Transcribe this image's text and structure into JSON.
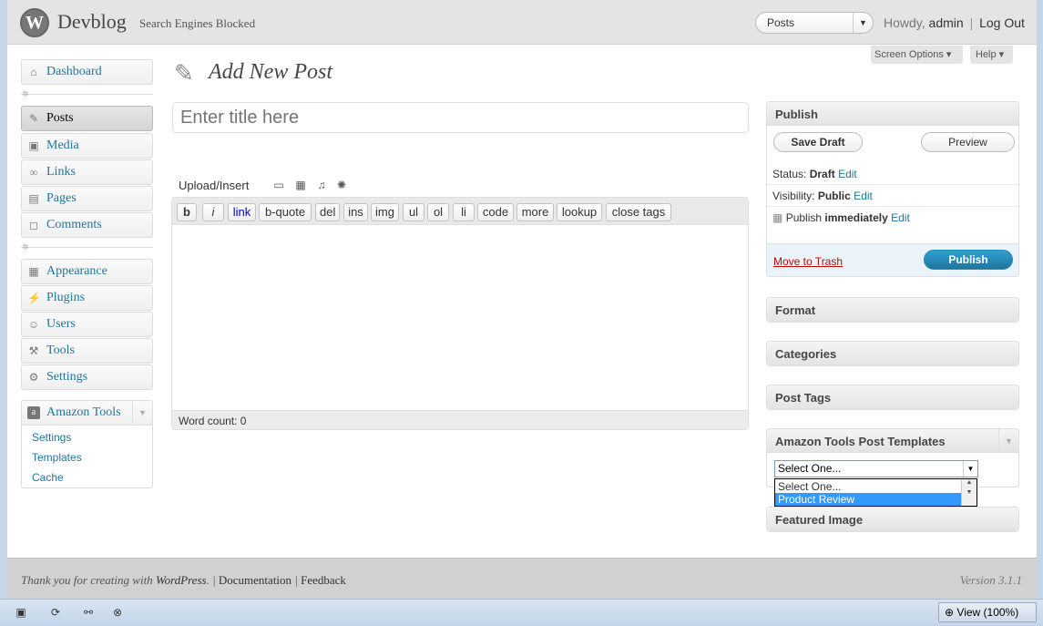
{
  "header": {
    "logo_glyph": "W",
    "site_title": "Devblog",
    "site_status": "Search Engines Blocked",
    "favorite_action": "Posts",
    "howdy": "Howdy,",
    "username": "admin",
    "logout": "Log Out"
  },
  "screen_meta": {
    "screen_options": "Screen Options ▾",
    "help": "Help ▾"
  },
  "menu": {
    "dashboard": "Dashboard",
    "posts": "Posts",
    "media": "Media",
    "links": "Links",
    "pages": "Pages",
    "comments": "Comments",
    "appearance": "Appearance",
    "plugins": "Plugins",
    "users": "Users",
    "tools": "Tools",
    "settings": "Settings",
    "amazon_tools": "Amazon Tools",
    "amazon_sub": [
      "Settings",
      "Templates",
      "Cache"
    ]
  },
  "main": {
    "page_title": "Add New Post",
    "title_placeholder": "Enter title here",
    "upload_insert": "Upload/Insert",
    "quicktags": [
      "b",
      "i",
      "link",
      "b-quote",
      "del",
      "ins",
      "img",
      "ul",
      "ol",
      "li",
      "code",
      "more",
      "lookup",
      "close tags"
    ],
    "word_count": "Word count: 0"
  },
  "publish": {
    "title": "Publish",
    "save_draft": "Save Draft",
    "preview": "Preview",
    "status_label": "Status:",
    "status_value": "Draft",
    "visibility_label": "Visibility:",
    "visibility_value": "Public",
    "publish_label": "Publish",
    "publish_value": "immediately",
    "edit": "Edit",
    "move_to_trash": "Move to Trash",
    "publish_button": "Publish"
  },
  "boxes": {
    "format": "Format",
    "categories": "Categories",
    "post_tags": "Post Tags",
    "amazon_templates": "Amazon Tools Post Templates",
    "template_selected": "Select One...",
    "template_options": [
      "Select One...",
      "Product Review"
    ],
    "featured_image": "Featured Image"
  },
  "footer": {
    "thank_you": "Thank you for creating with",
    "wordpress": "WordPress",
    "documentation": "Documentation",
    "feedback": "Feedback",
    "version": "Version 3.1.1"
  },
  "statusbar": {
    "zoom": "View (100%)"
  },
  "colors": {
    "link": "#21759b",
    "publish_button": "#21759b",
    "trash": "#bc0b0b"
  }
}
